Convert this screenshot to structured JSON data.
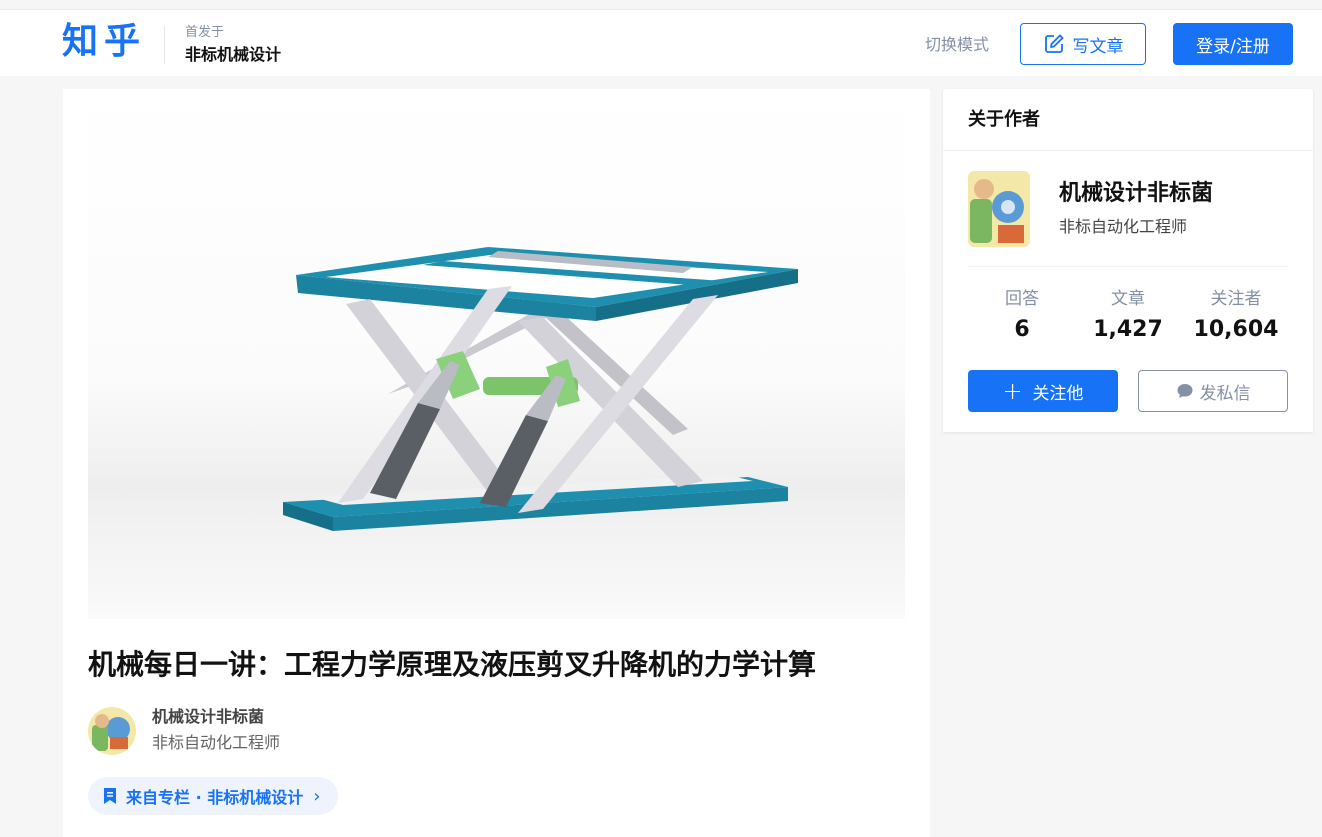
{
  "header": {
    "logo": "知乎",
    "published_label": "首发于",
    "column_name": "非标机械设计",
    "mode_toggle": "切换模式",
    "write_button": "写文章",
    "login_button": "登录/注册"
  },
  "article": {
    "title": "机械每日一讲：工程力学原理及液压剪叉升降机的力学计算",
    "author_name": "机械设计非标菌",
    "author_bio": "非标自动化工程师",
    "column_tag": "来自专栏 · 非标机械设计"
  },
  "sidebar": {
    "title": "关于作者",
    "author_name": "机械设计非标菌",
    "author_bio": "非标自动化工程师",
    "stats": [
      {
        "label": "回答",
        "value": "6"
      },
      {
        "label": "文章",
        "value": "1,427"
      },
      {
        "label": "关注者",
        "value": "10,604"
      }
    ],
    "follow_button": "关注他",
    "message_button": "发私信"
  },
  "colors": {
    "brand_blue": "#1772f6",
    "frame_teal": "#1f8fb0",
    "cylinder_gray": "#5a5f66",
    "mount_green": "#7bc46a"
  }
}
